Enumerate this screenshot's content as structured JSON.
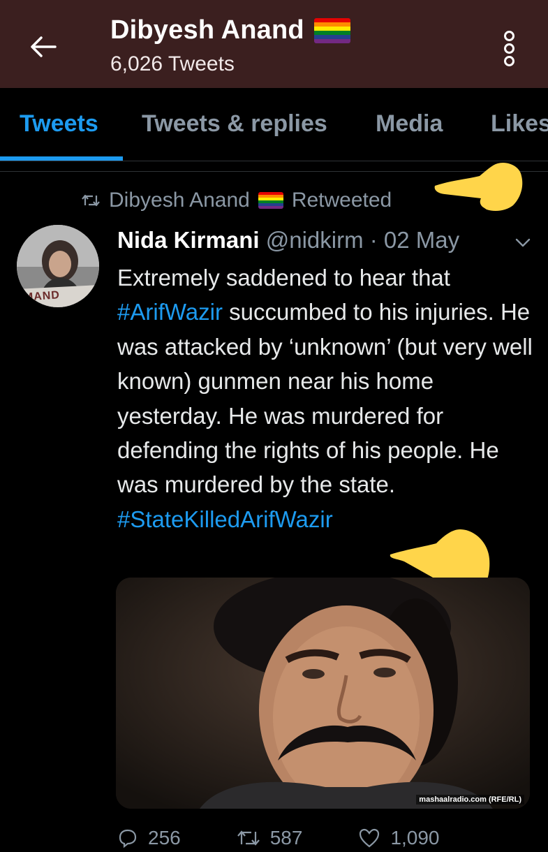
{
  "header": {
    "title": "Dibyesh Anand",
    "tweet_count": "6,026 Tweets",
    "back_icon": "arrow-left-icon",
    "more_icon": "more-vertical-icon",
    "background": "#3b1f1f"
  },
  "tabs": [
    {
      "label": "Tweets",
      "active": true
    },
    {
      "label": "Tweets & replies",
      "active": false
    },
    {
      "label": "Media",
      "active": false
    },
    {
      "label": "Likes",
      "active": false
    }
  ],
  "retweet": {
    "label": "Dibyesh Anand",
    "suffix": "Retweeted",
    "icon": "retweet-icon"
  },
  "tweet": {
    "name": "Nida Kirmani",
    "handle_date": "@nidkirm · 02 May",
    "text_before": "Extremely saddened to hear that",
    "hashtag1": "#ArifWazir",
    "text_middle": " succumbed to his injuries. He was attacked by ‘unknown’ (but very well known) gunmen near his home yesterday. He was murdered for defending the rights of his people. He was murdered by the state.",
    "hashtag2": "#StateKilledArifWazir",
    "avatar_sign_text": "MAND",
    "media_credit": "mashaalradio.com (RFE/RL)"
  },
  "actions": {
    "reply": "256",
    "retweet": "587",
    "like": "1,090"
  },
  "colors": {
    "accent": "#1d9bf0",
    "muted": "#8b98a5",
    "hand": "#ffd54a"
  }
}
